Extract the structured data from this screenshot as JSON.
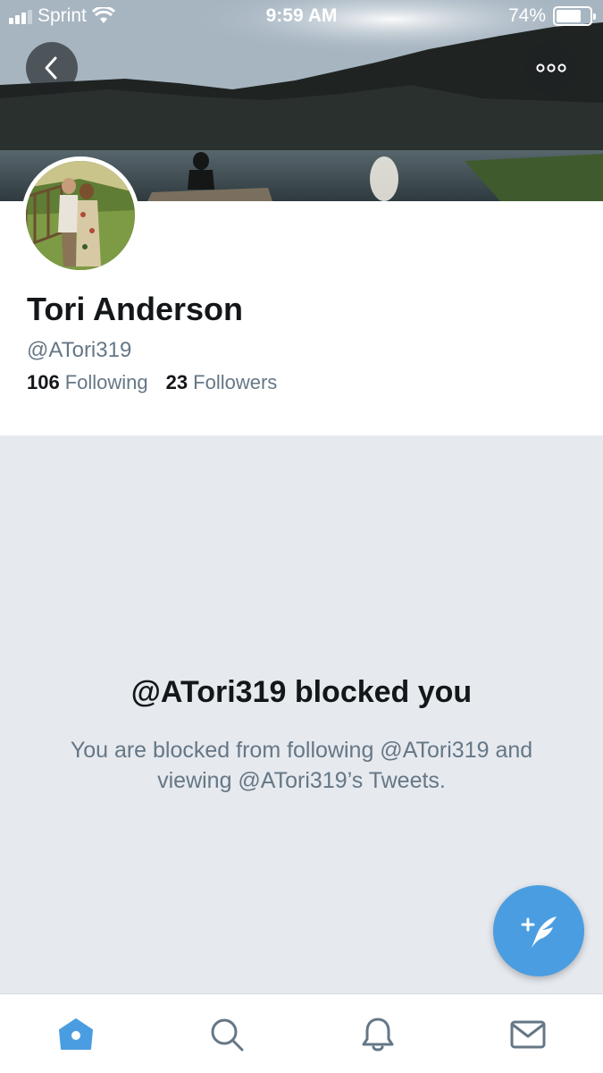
{
  "status_bar": {
    "carrier": "Sprint",
    "time": "9:59 AM",
    "battery": "74%",
    "battery_level": 0.74,
    "signal_bars": 3
  },
  "header": {
    "back_icon": "chevron-left-icon",
    "more_icon": "ellipsis-icon"
  },
  "profile": {
    "name": "Tori Anderson",
    "handle": "@ATori319",
    "following_count": "106",
    "following_label": "Following",
    "followers_count": "23",
    "followers_label": "Followers"
  },
  "blocked": {
    "title": "@ATori319 blocked you",
    "message": "You are blocked from following @ATori319 and viewing @ATori319’s Tweets."
  },
  "compose": {
    "icon": "compose-tweet-icon",
    "color": "#4a9de0"
  },
  "tab_bar": {
    "tabs": [
      {
        "name": "home",
        "icon": "home-icon",
        "active": true
      },
      {
        "name": "search",
        "icon": "search-icon",
        "active": false
      },
      {
        "name": "notifications",
        "icon": "bell-icon",
        "active": false
      },
      {
        "name": "messages",
        "icon": "mail-icon",
        "active": false
      }
    ],
    "active_color": "#4a9de0",
    "inactive_color": "#657786"
  }
}
